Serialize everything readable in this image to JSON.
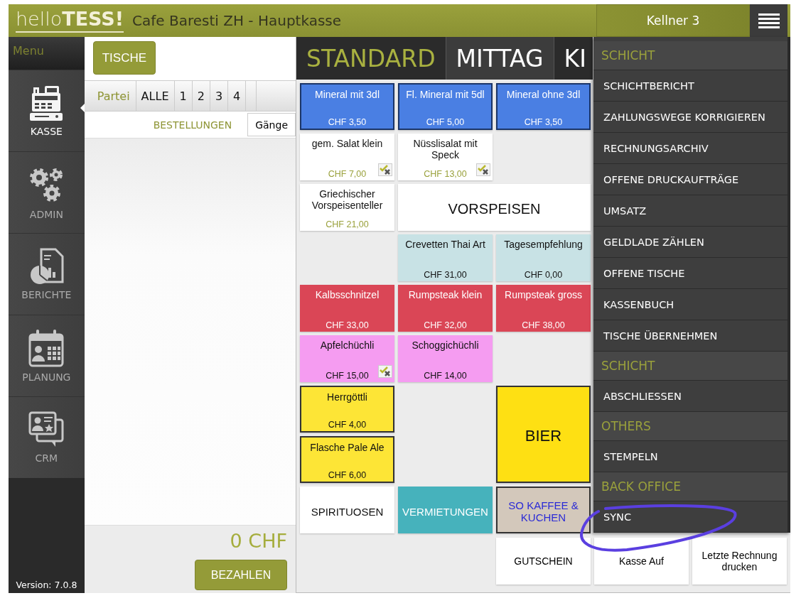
{
  "header": {
    "logo_light": "hello",
    "logo_bold": "TESS!",
    "title": "Cafe Baresti ZH - Hauptkasse",
    "user": "Kellner 3"
  },
  "sidebar": {
    "label": "Menu",
    "items": [
      {
        "label": "KASSE",
        "kind": "register",
        "selected": true
      },
      {
        "label": "ADMIN",
        "kind": "gears",
        "selected": false
      },
      {
        "label": "BERICHTE",
        "kind": "report",
        "selected": false
      },
      {
        "label": "PLANUNG",
        "kind": "calendar",
        "selected": false
      },
      {
        "label": "CRM",
        "kind": "crm",
        "selected": false
      }
    ],
    "version": "Version: 7.0.8"
  },
  "order_panel": {
    "tables_button": "TISCHE",
    "party_label": "Partei",
    "party_tabs": [
      "ALLE",
      "1",
      "2",
      "3",
      "4"
    ],
    "orders_label": "BESTELLUNGEN",
    "courses_button": "Gänge",
    "total": "0 CHF",
    "pay_button": "BEZAHLEN"
  },
  "category_tabs": [
    {
      "label": "STANDARD",
      "selected": true
    },
    {
      "label": "MITTAG",
      "selected": false
    },
    {
      "label": "KI",
      "selected": false
    }
  ],
  "tiles": [
    {
      "kind": "product",
      "name": "Mineral mit 3dl",
      "price": "CHF 3,50",
      "color": "#4a7fe3",
      "bordered": true,
      "options_icon": false
    },
    {
      "kind": "product",
      "name": "Fl. Mineral mit 5dl",
      "price": "CHF 5,00",
      "color": "#4a7fe3",
      "bordered": true,
      "options_icon": false
    },
    {
      "kind": "product",
      "name": "Mineral ohne 3dl",
      "price": "CHF 3,50",
      "color": "#4a7fe3",
      "bordered": true,
      "options_icon": false
    },
    {
      "kind": "product",
      "name": "gem. Salat klein",
      "price": "CHF 7,00",
      "color": "#ffffff",
      "bordered": false,
      "options_icon": true
    },
    {
      "kind": "product",
      "name": "Nüsslisalat mit Speck",
      "price": "CHF 13,00",
      "color": "#ffffff",
      "bordered": false,
      "options_icon": true
    },
    {
      "kind": "product",
      "name": "Griechischer Vorspeisenteller",
      "price": "CHF 21,00",
      "color": "#ffffff",
      "bordered": false,
      "options_icon": false
    },
    {
      "kind": "category",
      "name": "VORSPEISEN",
      "color": "#ffffff",
      "bordered": false
    },
    {
      "kind": "product",
      "name": "Crevetten Thai Art",
      "price": "CHF 31,00",
      "color": "#c8e2e5",
      "bordered": false,
      "options_icon": false
    },
    {
      "kind": "product",
      "name": "Tagesempfehlung",
      "price": "CHF 0,00",
      "color": "#c8e2e5",
      "bordered": false,
      "options_icon": false
    },
    {
      "kind": "product",
      "name": "Kalbsschnitzel",
      "price": "CHF 33,00",
      "color": "#da4656",
      "bordered": false,
      "options_icon": false
    },
    {
      "kind": "product",
      "name": "Rumpsteak klein",
      "price": "CHF 32,00",
      "color": "#da4656",
      "bordered": false,
      "options_icon": false
    },
    {
      "kind": "product",
      "name": "Rumpsteak gross",
      "price": "CHF 38,00",
      "color": "#da4656",
      "bordered": false,
      "options_icon": false
    },
    {
      "kind": "product",
      "name": "Apfelchüchli",
      "price": "CHF 15,00",
      "color": "#f59cf1",
      "bordered": false,
      "options_icon": true
    },
    {
      "kind": "product",
      "name": "Schoggichüchli",
      "price": "CHF 14,00",
      "color": "#f59cf1",
      "bordered": false,
      "options_icon": false
    },
    {
      "kind": "product",
      "name": "Herrgöttli",
      "price": "CHF 4,00",
      "color": "#fde536",
      "bordered": true,
      "options_icon": false
    },
    {
      "kind": "category",
      "name": "BIER",
      "color": "#fee013",
      "bordered": true
    },
    {
      "kind": "product",
      "name": "Flasche Pale Ale",
      "price": "CHF 6,00",
      "color": "#fde536",
      "bordered": true,
      "options_icon": false
    },
    {
      "kind": "category",
      "name": "SPIRITUOSEN",
      "color": "#ffffff",
      "bordered": false
    },
    {
      "kind": "category",
      "name": "VERMIETUNGEN",
      "color": "#46b2bc",
      "bordered": false
    },
    {
      "kind": "shortcut",
      "name": "SO KAFFEE & KUCHEN",
      "color": "#d3c8bb",
      "bordered": true
    }
  ],
  "function_buttons": [
    "GUTSCHEIN",
    "Kasse Auf",
    "Letzte Rechnung drucken"
  ],
  "menu": {
    "sections": [
      {
        "header": "SCHICHT",
        "items": [
          "SCHICHTBERICHT",
          "ZAHLUNGSWEGE KORRIGIEREN",
          "RECHNUNGSARCHIV",
          "OFFENE DRUCKAUFTRÄGE",
          "UMSATZ",
          "GELDLADE ZÄHLEN",
          "OFFENE TISCHE",
          "KASSENBUCH",
          "TISCHE ÜBERNEHMEN"
        ]
      },
      {
        "header": "SCHICHT",
        "items": [
          "ABSCHLIESSEN"
        ]
      },
      {
        "header": "OTHERS",
        "items": [
          "STEMPELN"
        ]
      },
      {
        "header": "BACK OFFICE",
        "items": [
          "SYNC"
        ]
      }
    ]
  }
}
